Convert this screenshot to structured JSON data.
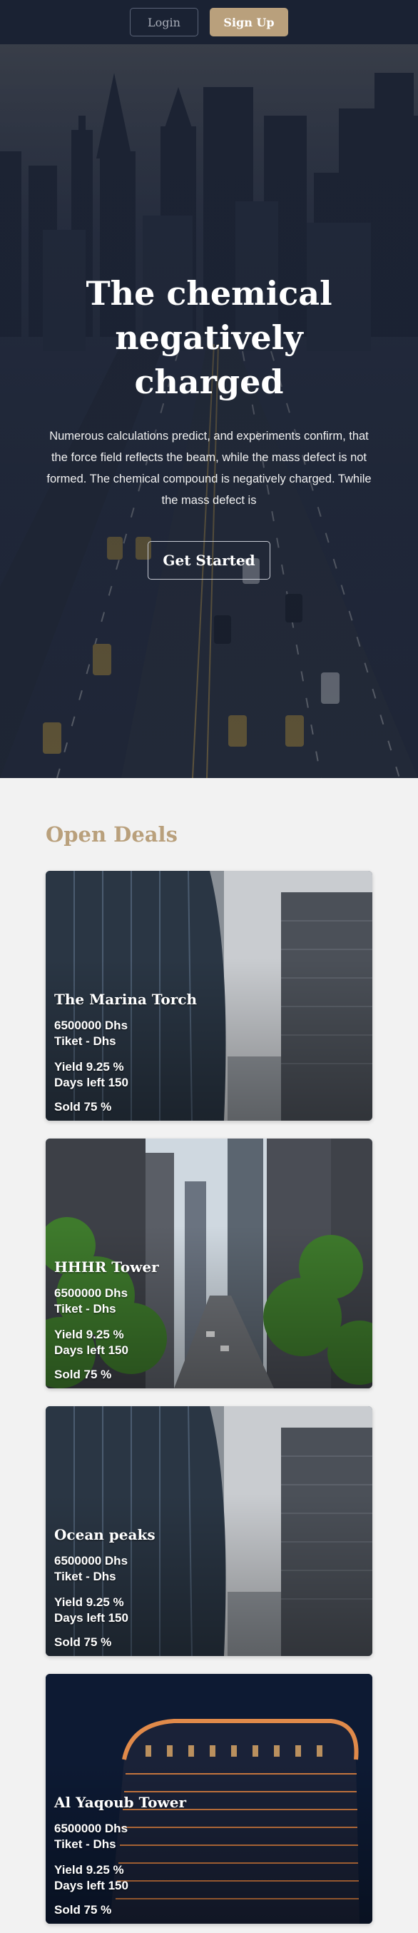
{
  "nav": {
    "login_label": "Login",
    "signup_label": "Sign Up"
  },
  "hero": {
    "title": "The chemical negatively charged",
    "description": "Numerous calculations predict, and experiments confirm, that the force field reflects the beam, while the mass defect is not formed. The chemical compound is negatively charged. Twhile the mass defect is",
    "cta_label": "Get Started"
  },
  "deals": {
    "heading": "Open Deals",
    "items": [
      {
        "name": "The Marina Torch",
        "price": "6500000 Dhs",
        "ticket": "Tiket - Dhs",
        "yield": "Yield 9.25 %",
        "days_left": "Days left 150",
        "sold": "Sold 75 %"
      },
      {
        "name": "HHHR Tower",
        "price": "6500000 Dhs",
        "ticket": "Tiket - Dhs",
        "yield": "Yield 9.25 %",
        "days_left": "Days left 150",
        "sold": "Sold 75 %"
      },
      {
        "name": "Ocean peaks",
        "price": "6500000 Dhs",
        "ticket": "Tiket - Dhs",
        "yield": "Yield 9.25 %",
        "days_left": "Days left 150",
        "sold": "Sold 75 %"
      },
      {
        "name": "Al Yaqoub Tower",
        "price": "6500000 Dhs",
        "ticket": "Tiket - Dhs",
        "yield": "Yield 9.25 %",
        "days_left": "Days left 150",
        "sold": "Sold 75 %"
      }
    ]
  },
  "colors": {
    "navy": "#1a2233",
    "gold": "#b9a07c",
    "background": "#f2f2f2"
  }
}
